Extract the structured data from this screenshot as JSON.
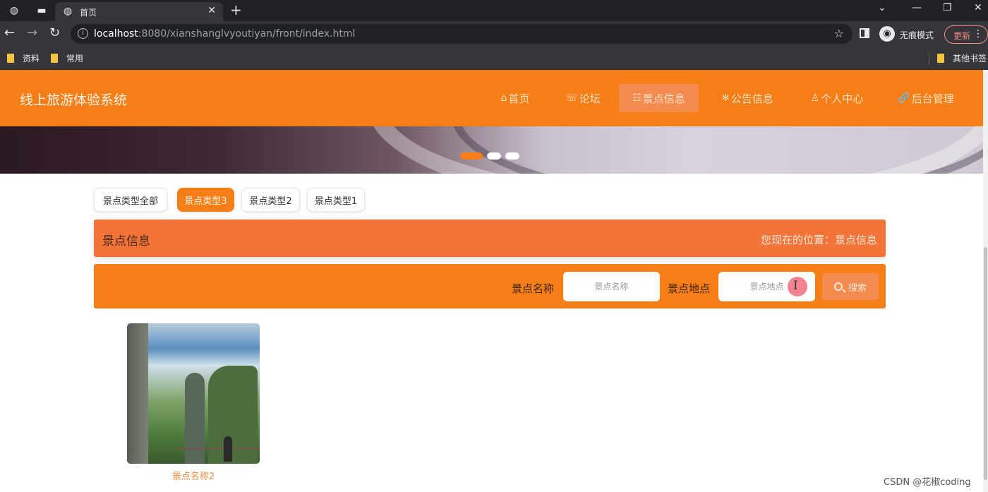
{
  "browser": {
    "tab_title": "首页",
    "url_host": "localhost",
    "url_rest": ":8080/xianshanglvyoutiyan/front/index.html",
    "incognito_label": "无痕模式",
    "update_label": "更新",
    "bookmarks": [
      "资料",
      "常用"
    ],
    "other_bookmarks": "其他书签"
  },
  "site": {
    "title": "线上旅游体验系统",
    "nav": [
      {
        "icon": "⌂",
        "label": "首页"
      },
      {
        "icon": "☏",
        "label": "论坛"
      },
      {
        "icon": "☷",
        "label": "景点信息"
      },
      {
        "icon": "❄",
        "label": "公告信息"
      },
      {
        "icon": "♙",
        "label": "个人中心"
      },
      {
        "icon": "🔗",
        "label": "后台管理"
      }
    ],
    "active_nav": "景点信息",
    "accent_color": "#f57e16"
  },
  "banner": {
    "slide_count": 3,
    "active_slide": 1
  },
  "categories": [
    "景点类型全部",
    "景点类型3",
    "景点类型2",
    "景点类型1"
  ],
  "active_category": "景点类型3",
  "section": {
    "title": "景点信息",
    "breadcrumb": "您现在的位置：景点信息"
  },
  "search": {
    "name_label": "景点名称",
    "name_placeholder": "景点名称",
    "location_label": "景点地点",
    "location_placeholder": "景点地点",
    "button_label": "搜索"
  },
  "cards": [
    {
      "name": "景点名称2"
    }
  ],
  "watermark": "CSDN @花椒coding"
}
